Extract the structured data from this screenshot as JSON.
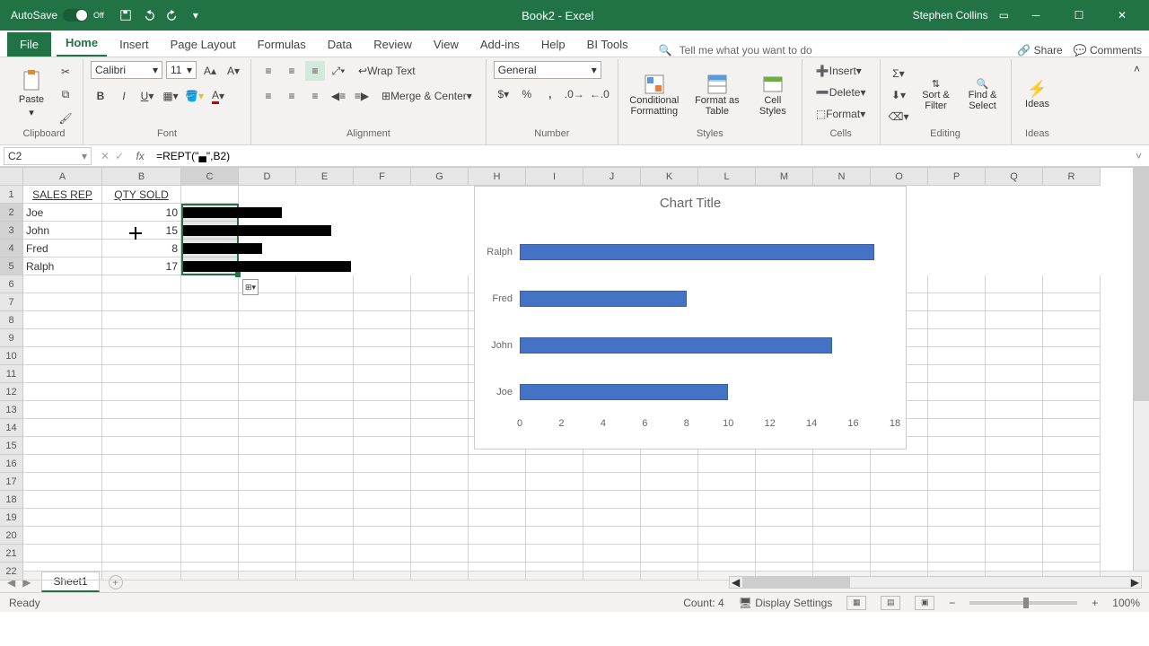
{
  "title_bar": {
    "autosave_label": "AutoSave",
    "autosave_state": "Off",
    "doc_title": "Book2 - Excel",
    "user_name": "Stephen Collins"
  },
  "tabs": {
    "file": "File",
    "home": "Home",
    "insert": "Insert",
    "page_layout": "Page Layout",
    "formulas": "Formulas",
    "data": "Data",
    "review": "Review",
    "view": "View",
    "addins": "Add-ins",
    "help": "Help",
    "bi": "BI Tools",
    "search_ph": "Tell me what you want to do",
    "share": "Share",
    "comments": "Comments"
  },
  "ribbon": {
    "clipboard": {
      "paste": "Paste",
      "label": "Clipboard"
    },
    "font": {
      "name": "Calibri",
      "size": "11",
      "label": "Font"
    },
    "alignment": {
      "wrap": "Wrap Text",
      "merge": "Merge & Center",
      "label": "Alignment"
    },
    "number": {
      "format": "General",
      "label": "Number"
    },
    "styles": {
      "cond": "Conditional Formatting",
      "fmt_table": "Format as Table",
      "cell_styles": "Cell Styles",
      "label": "Styles"
    },
    "cells": {
      "insert": "Insert",
      "delete": "Delete",
      "format": "Format",
      "label": "Cells"
    },
    "editing": {
      "sort": "Sort & Filter",
      "find": "Find & Select",
      "label": "Editing"
    },
    "ideas": {
      "ideas": "Ideas",
      "label": "Ideas"
    }
  },
  "formula_bar": {
    "name_box": "C2",
    "formula": "=REPT(\"▄\",B2)"
  },
  "columns": [
    "A",
    "B",
    "C",
    "D",
    "E",
    "F",
    "G",
    "H",
    "I",
    "J",
    "K",
    "L",
    "M",
    "N",
    "O",
    "P",
    "Q",
    "R"
  ],
  "rows": [
    "1",
    "2",
    "3",
    "4",
    "5",
    "6",
    "7",
    "8",
    "9",
    "10",
    "11",
    "12",
    "13",
    "14",
    "15",
    "16",
    "17",
    "18",
    "19",
    "20",
    "21",
    "22"
  ],
  "data": {
    "header_a": "SALES REP",
    "header_b": "QTY SOLD",
    "r": [
      {
        "name": "Joe",
        "qty": 10
      },
      {
        "name": "John",
        "qty": 15
      },
      {
        "name": "Fred",
        "qty": 8
      },
      {
        "name": "Ralph",
        "qty": 17
      }
    ]
  },
  "chart_data": {
    "type": "bar",
    "title": "Chart Title",
    "categories": [
      "Ralph",
      "Fred",
      "John",
      "Joe"
    ],
    "values": [
      17,
      8,
      15,
      10
    ],
    "xlabel": "",
    "ylabel": "",
    "xlim": [
      0,
      18
    ],
    "x_ticks": [
      0,
      2,
      4,
      6,
      8,
      10,
      12,
      14,
      16,
      18
    ]
  },
  "sheet": {
    "tab1": "Sheet1"
  },
  "status": {
    "ready": "Ready",
    "count": "Count: 4",
    "display": "Display Settings",
    "zoom": "100%"
  }
}
